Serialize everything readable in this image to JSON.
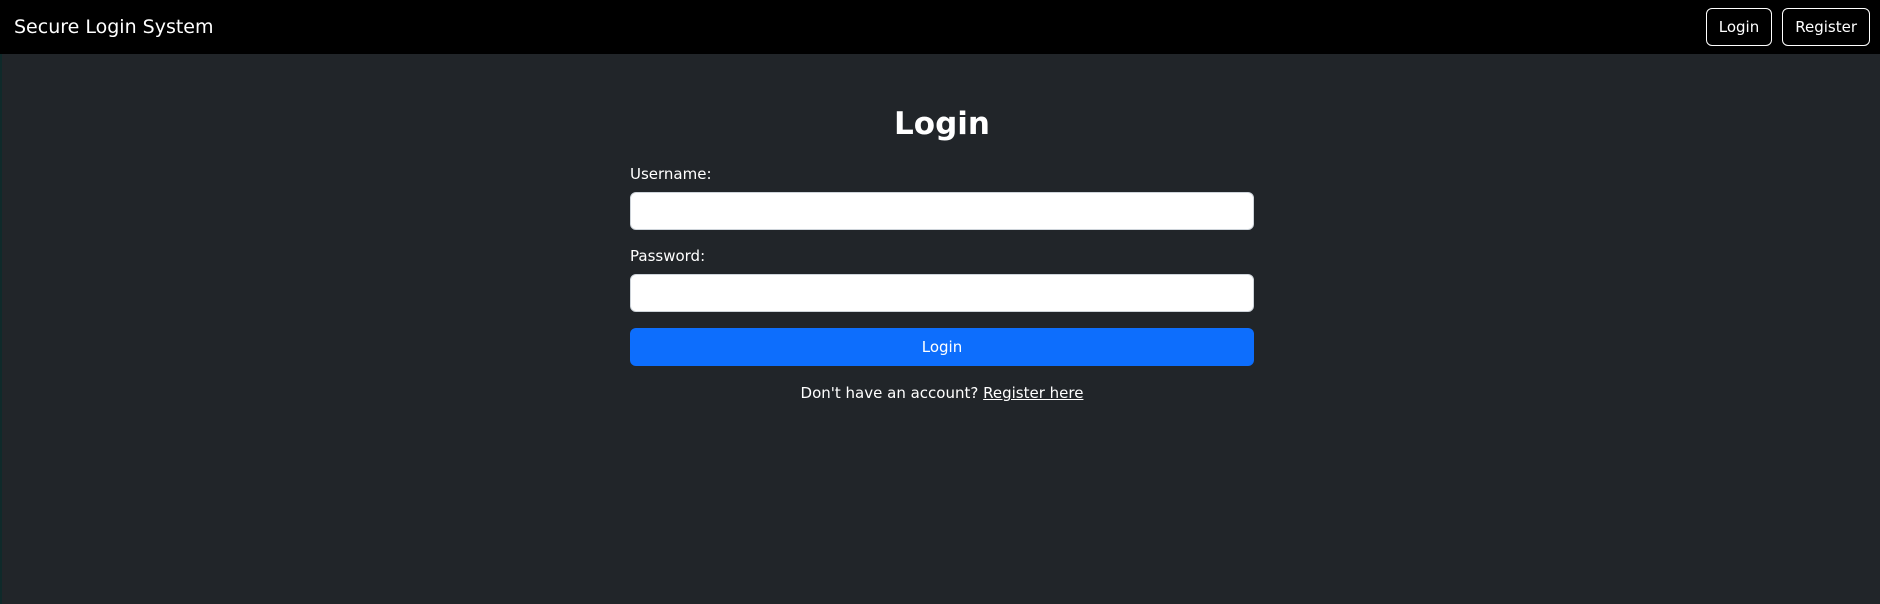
{
  "navbar": {
    "brand": "Secure Login System",
    "login_label": "Login",
    "register_label": "Register"
  },
  "form": {
    "title": "Login",
    "username_label": "Username:",
    "username_value": "",
    "password_label": "Password:",
    "password_value": "",
    "submit_label": "Login"
  },
  "footer": {
    "prompt": "Don't have an account?",
    "register_link": "Register here"
  },
  "colors": {
    "background": "#212529",
    "navbar": "#000000",
    "primary": "#0d6efd"
  }
}
